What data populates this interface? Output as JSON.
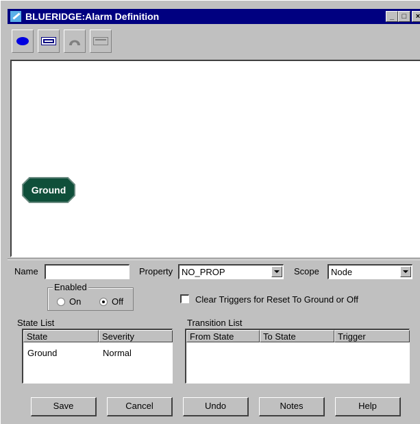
{
  "window": {
    "title": "BLUERIDGE:Alarm Definition",
    "controls": {
      "minimize": "_",
      "maximize": "□",
      "close": "×"
    }
  },
  "toolbar": {
    "tools": [
      "state-ellipse-icon",
      "transition-box-icon",
      "arrow-loop-icon",
      "disabled-tool-icon"
    ]
  },
  "canvas": {
    "nodes": [
      {
        "label": "Ground",
        "color": "#0f4f3a"
      }
    ]
  },
  "form": {
    "name_label": "Name",
    "name_value": "",
    "property_label": "Property",
    "property_value": "NO_PROP",
    "scope_label": "Scope",
    "scope_value": "Node",
    "enabled_group": "Enabled",
    "radio_on": "On",
    "radio_off": "Off",
    "enabled_selected": "Off",
    "clear_triggers_label": "Clear Triggers for Reset To Ground or Off",
    "clear_triggers_checked": false
  },
  "state_list": {
    "title": "State List",
    "columns": [
      "State",
      "Severity"
    ],
    "rows": [
      [
        "Ground",
        "Normal"
      ]
    ]
  },
  "transition_list": {
    "title": "Transition List",
    "columns": [
      "From State",
      "To State",
      "Trigger"
    ],
    "rows": []
  },
  "buttons": {
    "save": "Save",
    "cancel": "Cancel",
    "undo": "Undo",
    "notes": "Notes",
    "help": "Help"
  },
  "colors": {
    "titlebar": "#000080",
    "face": "#c0c0c0",
    "node": "#0f4f3a"
  }
}
